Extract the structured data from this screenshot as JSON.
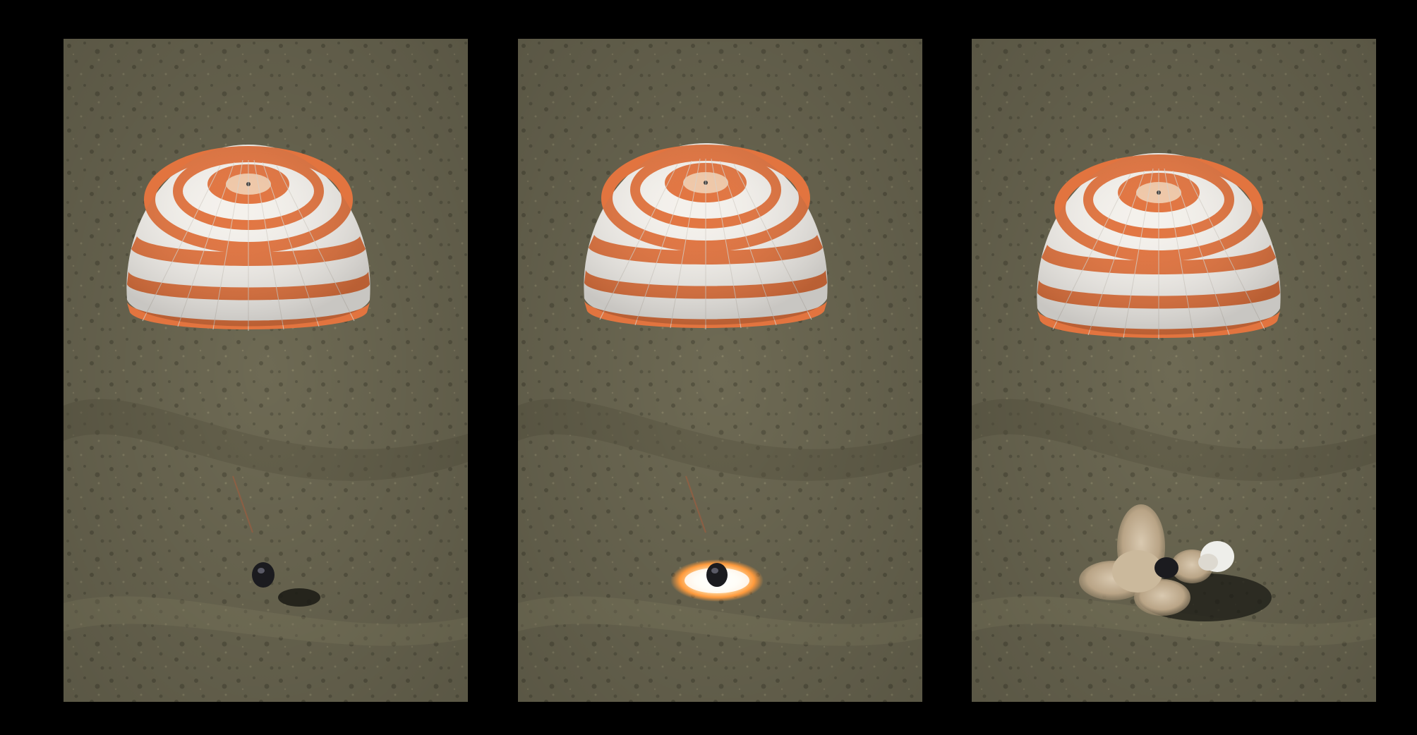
{
  "sequence": {
    "frame_count": 3,
    "frames": [
      {
        "stage": "descent",
        "index": 1
      },
      {
        "stage": "soft-landing-engine-firing",
        "index": 2
      },
      {
        "stage": "touchdown-dust-cloud",
        "index": 3
      }
    ]
  },
  "colors": {
    "background": "#000000",
    "terrain": "#6e6a54",
    "terrain_dark": "#4f4c3a",
    "terrain_light": "#8a8468",
    "canopy_white": "#f4f1ec",
    "canopy_orange": "#e2743f",
    "capsule": "#1b1b1f",
    "flash": "#fff1c8",
    "flash_glow": "#ff9a3c",
    "dust": "#c8b69c"
  }
}
